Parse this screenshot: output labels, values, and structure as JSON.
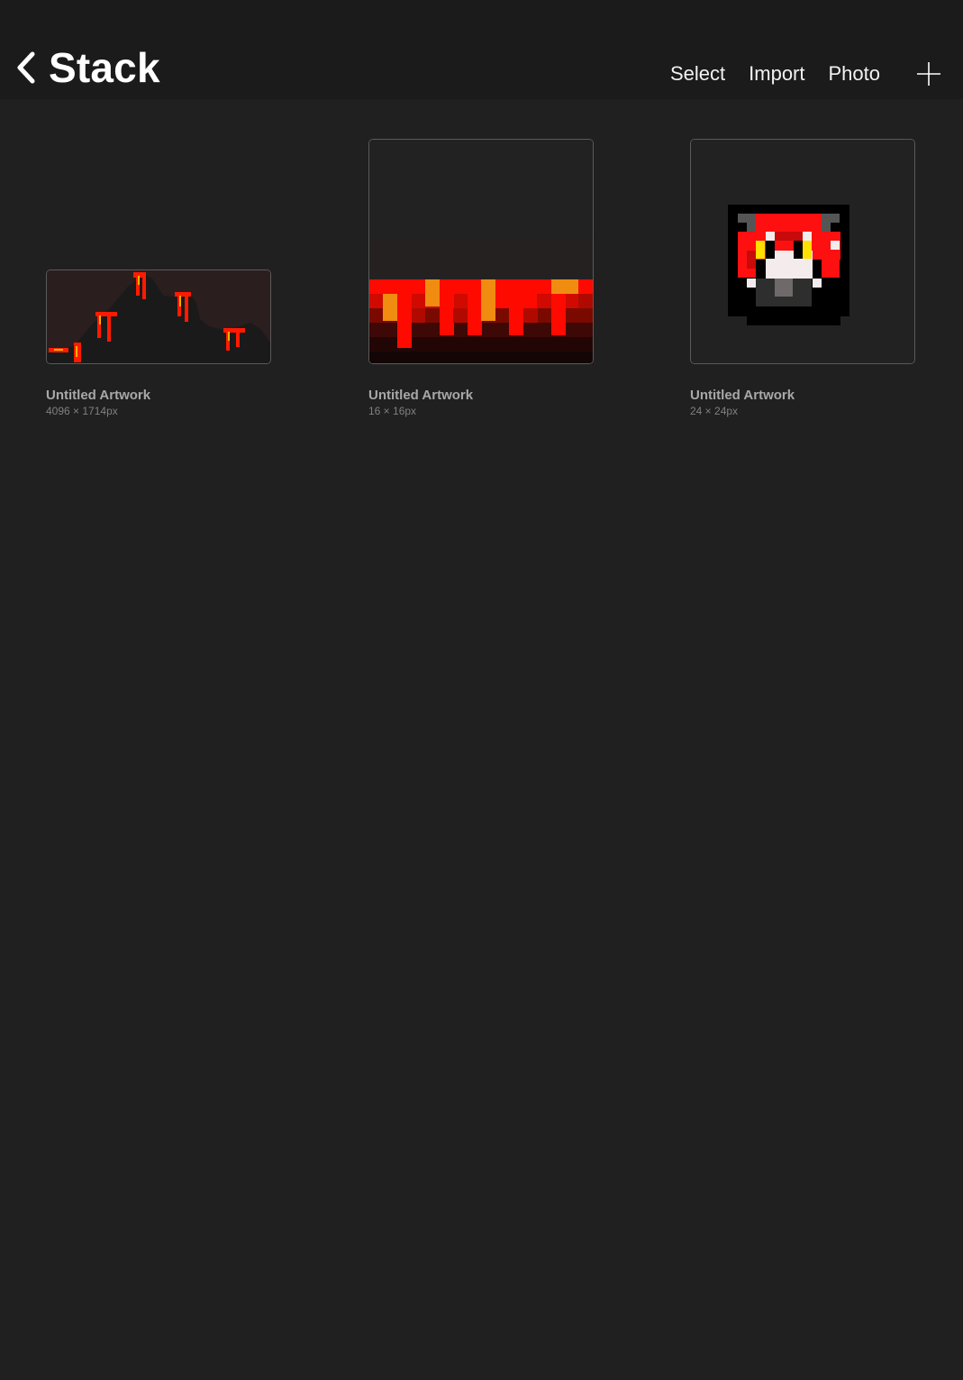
{
  "header": {
    "title": "Stack",
    "actions": {
      "select": "Select",
      "import": "Import",
      "photo": "Photo"
    }
  },
  "artworks": [
    {
      "name": "Untitled Artwork",
      "size": "4096 × 1714px"
    },
    {
      "name": "Untitled Artwork",
      "size": "16 × 16px"
    },
    {
      "name": "Untitled Artwork",
      "size": "24 × 24px"
    }
  ],
  "icons": {
    "back": "chevron-left-icon",
    "add": "plus-icon"
  },
  "colors": {
    "background": "#202020",
    "header": "#1b1b1b",
    "lava_red": "#ff0000",
    "lava_orange": "#f08c10"
  }
}
